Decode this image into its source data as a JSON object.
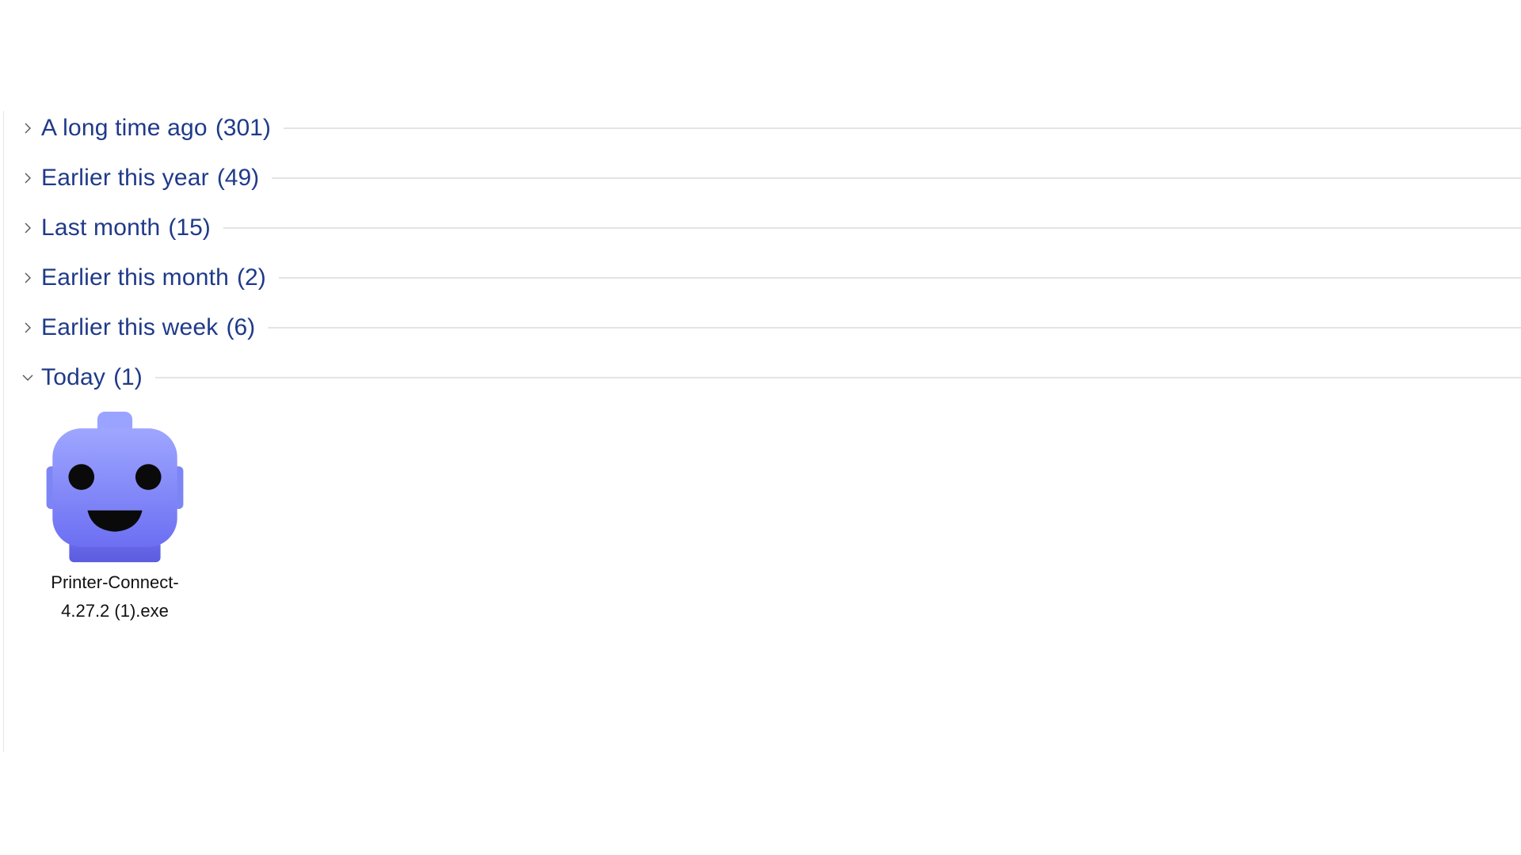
{
  "groups": [
    {
      "label": "A long time ago",
      "count": "(301)",
      "expanded": false,
      "icon": "chevron-right-icon"
    },
    {
      "label": "Earlier this year",
      "count": "(49)",
      "expanded": false,
      "icon": "chevron-right-icon"
    },
    {
      "label": "Last month",
      "count": "(15)",
      "expanded": false,
      "icon": "chevron-right-icon"
    },
    {
      "label": "Earlier this month",
      "count": "(2)",
      "expanded": false,
      "icon": "chevron-right-icon"
    },
    {
      "label": "Earlier this week",
      "count": "(6)",
      "expanded": false,
      "icon": "chevron-right-icon"
    },
    {
      "label": "Today",
      "count": "(1)",
      "expanded": true,
      "icon": "chevron-down-icon"
    }
  ],
  "files": [
    {
      "name_line1": "Printer-Connect-",
      "name_line2": "4.27.2 (1).exe",
      "icon": "robot-app-icon"
    }
  ],
  "colors": {
    "group_text": "#1f3a8a",
    "divider": "#e4e4e4",
    "icon_body": "#7b7ff5"
  }
}
